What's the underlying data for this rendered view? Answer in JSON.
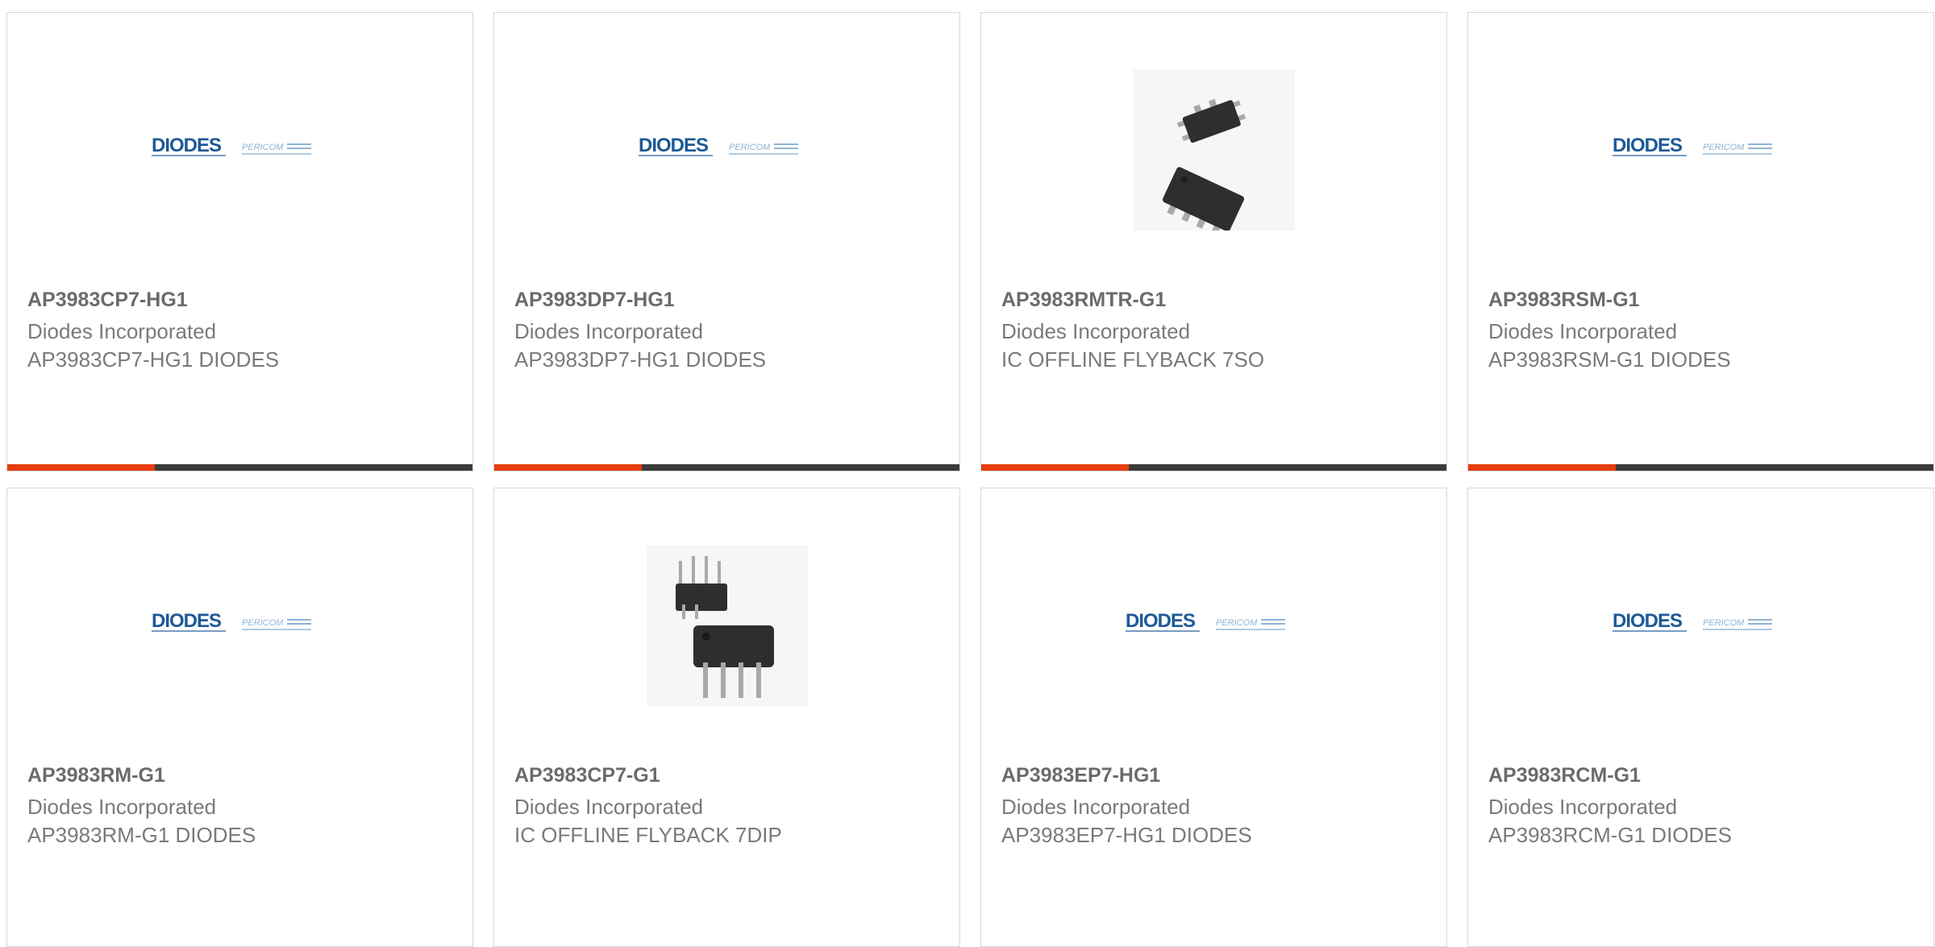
{
  "products": [
    {
      "part_number": "AP3983CP7-HG1",
      "manufacturer": "Diodes Incorporated",
      "description": "AP3983CP7-HG1 DIODES",
      "image": "diodes-logo",
      "logo_text": "DIODES",
      "logo_sub": "PERICOM",
      "show_bar": true
    },
    {
      "part_number": "AP3983DP7-HG1",
      "manufacturer": "Diodes Incorporated",
      "description": "AP3983DP7-HG1 DIODES",
      "image": "diodes-logo",
      "logo_text": "DIODES",
      "logo_sub": "PERICOM",
      "show_bar": true
    },
    {
      "part_number": "AP3983RMTR-G1",
      "manufacturer": "Diodes Incorporated",
      "description": "IC OFFLINE FLYBACK 7SO",
      "image": "soic-package",
      "show_bar": true
    },
    {
      "part_number": "AP3983RSM-G1",
      "manufacturer": "Diodes Incorporated",
      "description": "AP3983RSM-G1 DIODES",
      "image": "diodes-logo",
      "logo_text": "DIODES",
      "logo_sub": "PERICOM",
      "show_bar": true
    },
    {
      "part_number": "AP3983RM-G1",
      "manufacturer": "Diodes Incorporated",
      "description": "AP3983RM-G1 DIODES",
      "image": "diodes-logo",
      "logo_text": "DIODES",
      "logo_sub": "PERICOM",
      "show_bar": false
    },
    {
      "part_number": "AP3983CP7-G1",
      "manufacturer": "Diodes Incorporated",
      "description": "IC OFFLINE FLYBACK 7DIP",
      "image": "dip-package",
      "show_bar": false
    },
    {
      "part_number": "AP3983EP7-HG1",
      "manufacturer": "Diodes Incorporated",
      "description": "AP3983EP7-HG1 DIODES",
      "image": "diodes-logo",
      "logo_text": "DIODES",
      "logo_sub": "PERICOM",
      "show_bar": false
    },
    {
      "part_number": "AP3983RCM-G1",
      "manufacturer": "Diodes Incorporated",
      "description": "AP3983RCM-G1 DIODES",
      "image": "diodes-logo",
      "logo_text": "DIODES",
      "logo_sub": "PERICOM",
      "show_bar": false
    }
  ],
  "colors": {
    "accent": "#e63c0f",
    "bar_dark": "#3b3b3b",
    "logo_blue": "#1e5a96",
    "logo_light": "#8fb4d6",
    "chip_body": "#2e2e2e",
    "pin": "#a9a9a9"
  }
}
